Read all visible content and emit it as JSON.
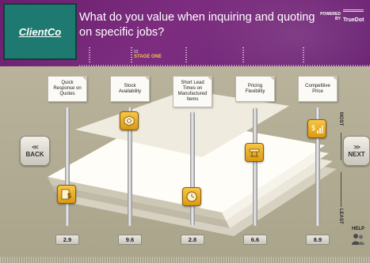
{
  "header": {
    "logo_text": "ClientCo",
    "question": "What do you value when inquiring and quoting on specific jobs?",
    "powered_by": "POWERED BY",
    "brand": "TrueDot",
    "stage_number": "02",
    "stage_label": "STAGE ONE",
    "background_color": "#6a1f6e"
  },
  "navigation": {
    "back_label": "BACK",
    "next_label": "NEXT",
    "back_icon": "double-chevron-left",
    "next_icon": "double-chevron-right"
  },
  "scale": {
    "top_label": "MOST",
    "bottom_label": "LEAST"
  },
  "criteria": [
    {
      "label": "Quick Response on Quotes",
      "value": "2.9",
      "icon": "dollar-document-icon",
      "level": 0.22
    },
    {
      "label": "Stock Availability",
      "value": "9.6",
      "icon": "inventory-box-icon",
      "level": 0.96
    },
    {
      "label": "Short Lead Times on Manufactured Items",
      "value": "2.8",
      "icon": "clock-icon",
      "level": 0.21
    },
    {
      "label": "Pricing Flexibility",
      "value": "6.6",
      "icon": "flexible-pricing-icon",
      "level": 0.64
    },
    {
      "label": "Competitive Price",
      "value": "8.9",
      "icon": "dollar-bar-chart-icon",
      "level": 0.88
    }
  ],
  "help": {
    "label": "HELP",
    "icon": "people-icon"
  },
  "colors": {
    "knob": "#f0b429",
    "accent": "#f4c542"
  }
}
